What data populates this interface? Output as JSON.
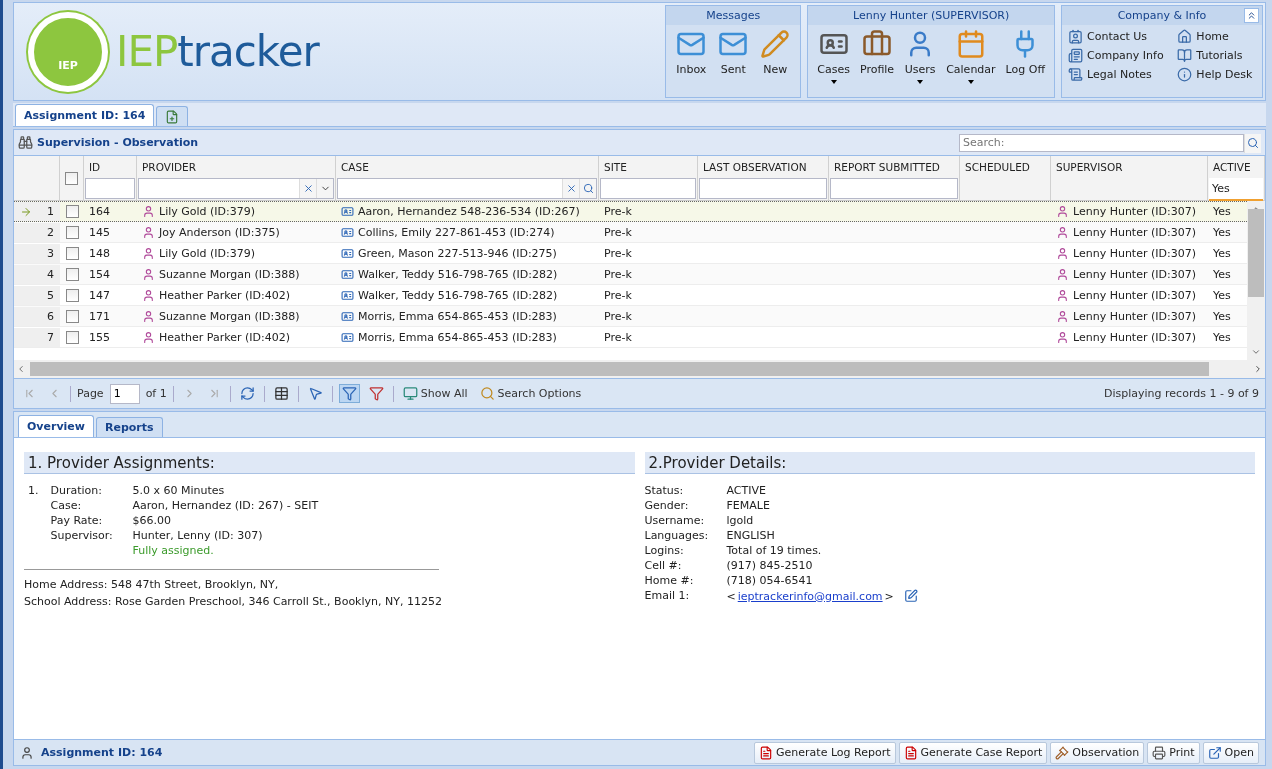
{
  "logo": {
    "badge": "IEP",
    "name_a": "IEP",
    "name_b": "tracker"
  },
  "groups": [
    {
      "title": "Messages",
      "buttons": [
        {
          "label": "Inbox",
          "has_menu": false
        },
        {
          "label": "Sent",
          "has_menu": false
        },
        {
          "label": "New",
          "has_menu": false
        }
      ]
    },
    {
      "title": "Lenny Hunter (SUPERVISOR)",
      "buttons": [
        {
          "label": "Cases",
          "has_menu": true
        },
        {
          "label": "Profile",
          "has_menu": false
        },
        {
          "label": "Users",
          "has_menu": true
        },
        {
          "label": "Calendar",
          "has_menu": true
        },
        {
          "label": "Log Off",
          "has_menu": false
        }
      ]
    }
  ],
  "info": {
    "title": "Company & Info",
    "links": [
      "Contact Us",
      "Home",
      "Company Info",
      "Tutorials",
      "Legal Notes",
      "Help Desk"
    ]
  },
  "top_tabs": [
    {
      "label": "Assignment ID: 164",
      "selected": true
    }
  ],
  "grid": {
    "title": "Supervision - Observation",
    "search": {
      "placeholder": "Search:"
    },
    "select_all_checked": false,
    "columns": [
      {
        "label": "ID",
        "kind": "text"
      },
      {
        "label": "PROVIDER",
        "kind": "combo"
      },
      {
        "label": "CASE",
        "kind": "lookup"
      },
      {
        "label": "SITE",
        "kind": "text"
      },
      {
        "label": "LAST OBSERVATION",
        "kind": "text"
      },
      {
        "label": "REPORT SUBMITTED",
        "kind": "text"
      },
      {
        "label": "SCHEDULED",
        "kind": "none"
      },
      {
        "label": "SUPERVISOR",
        "kind": "none"
      },
      {
        "label": "ACTIVE",
        "kind": "value",
        "value": "Yes"
      }
    ],
    "rows": [
      {
        "number": "1",
        "checked": false,
        "selected": true,
        "id": "164",
        "provider": "Lily Gold (ID:379)",
        "case": "Aaron, Hernandez 548-236-534 (ID:267)",
        "site": "Pre-k",
        "supervisor": "Lenny Hunter (ID:307)",
        "active": "Yes"
      },
      {
        "number": "2",
        "checked": false,
        "selected": false,
        "id": "145",
        "provider": "Joy Anderson (ID:375)",
        "case": "Collins, Emily 227-861-453 (ID:274)",
        "site": "Pre-k",
        "supervisor": "Lenny Hunter (ID:307)",
        "active": "Yes"
      },
      {
        "number": "3",
        "checked": false,
        "selected": false,
        "id": "148",
        "provider": "Lily Gold (ID:379)",
        "case": "Green, Mason 227-513-946 (ID:275)",
        "site": "Pre-k",
        "supervisor": "Lenny Hunter (ID:307)",
        "active": "Yes"
      },
      {
        "number": "4",
        "checked": false,
        "selected": false,
        "id": "154",
        "provider": "Suzanne Morgan (ID:388)",
        "case": "Walker, Teddy 516-798-765 (ID:282)",
        "site": "Pre-k",
        "supervisor": "Lenny Hunter (ID:307)",
        "active": "Yes"
      },
      {
        "number": "5",
        "checked": false,
        "selected": false,
        "id": "147",
        "provider": "Heather Parker (ID:402)",
        "case": "Walker, Teddy 516-798-765 (ID:282)",
        "site": "Pre-k",
        "supervisor": "Lenny Hunter (ID:307)",
        "active": "Yes"
      },
      {
        "number": "6",
        "checked": false,
        "selected": false,
        "id": "171",
        "provider": "Suzanne Morgan (ID:388)",
        "case": "Morris, Emma 654-865-453 (ID:283)",
        "site": "Pre-k",
        "supervisor": "Lenny Hunter (ID:307)",
        "active": "Yes"
      },
      {
        "number": "7",
        "checked": false,
        "selected": false,
        "id": "155",
        "provider": "Heather Parker (ID:402)",
        "case": "Morris, Emma 654-865-453 (ID:283)",
        "site": "Pre-k",
        "supervisor": "Lenny Hunter (ID:307)",
        "active": "Yes"
      }
    ],
    "paging": {
      "page_label": "Page",
      "page": "1",
      "of": "of 1",
      "filter_pressed": true,
      "show_all": "Show All",
      "search_options": "Search Options",
      "status": "Displaying records 1 - 9 of 9"
    }
  },
  "detail_tabs": [
    {
      "label": "Overview",
      "selected": true
    },
    {
      "label": "Reports",
      "selected": false
    }
  ],
  "assignments": {
    "title": "1. Provider Assignments:",
    "items": [
      {
        "number": "1.",
        "fields": [
          {
            "label": "Duration:",
            "value": "5.0 x 60 Minutes"
          },
          {
            "label": "Case:",
            "value": "Aaron, Hernandez (ID: 267) - SEIT"
          },
          {
            "label": "Pay Rate:",
            "value": "$66.00"
          },
          {
            "label": "Supervisor:",
            "value": "Hunter, Lenny (ID: 307)"
          }
        ],
        "note": "Fully assigned."
      }
    ],
    "addresses": [
      "Home Address: 548 47th Street, Brooklyn, NY,",
      "School Address: Rose Garden Preschool, 346 Carroll St., Booklyn, NY, 11252"
    ]
  },
  "details": {
    "title": "2.Provider Details:",
    "fields": [
      {
        "label": "Status:",
        "value": "ACTIVE"
      },
      {
        "label": "Gender:",
        "value": "FEMALE"
      },
      {
        "label": "Username:",
        "value": "lgold"
      },
      {
        "label": "Languages:",
        "value": "ENGLISH"
      },
      {
        "label": "Logins:",
        "value": "Total of 19 times."
      },
      {
        "label": "Cell #:",
        "value": "(917) 845-2510"
      },
      {
        "label": "Home #:",
        "value": "(718) 054-6541"
      }
    ],
    "email": {
      "label": "Email 1:",
      "before": "<",
      "link": "ieptrackerinfo@gmail.com",
      "after": ">"
    }
  },
  "footer": {
    "title": "Assignment ID: 164",
    "buttons": [
      "Generate Log Report",
      "Generate Case Report",
      "Observation",
      "Print",
      "Open"
    ]
  }
}
